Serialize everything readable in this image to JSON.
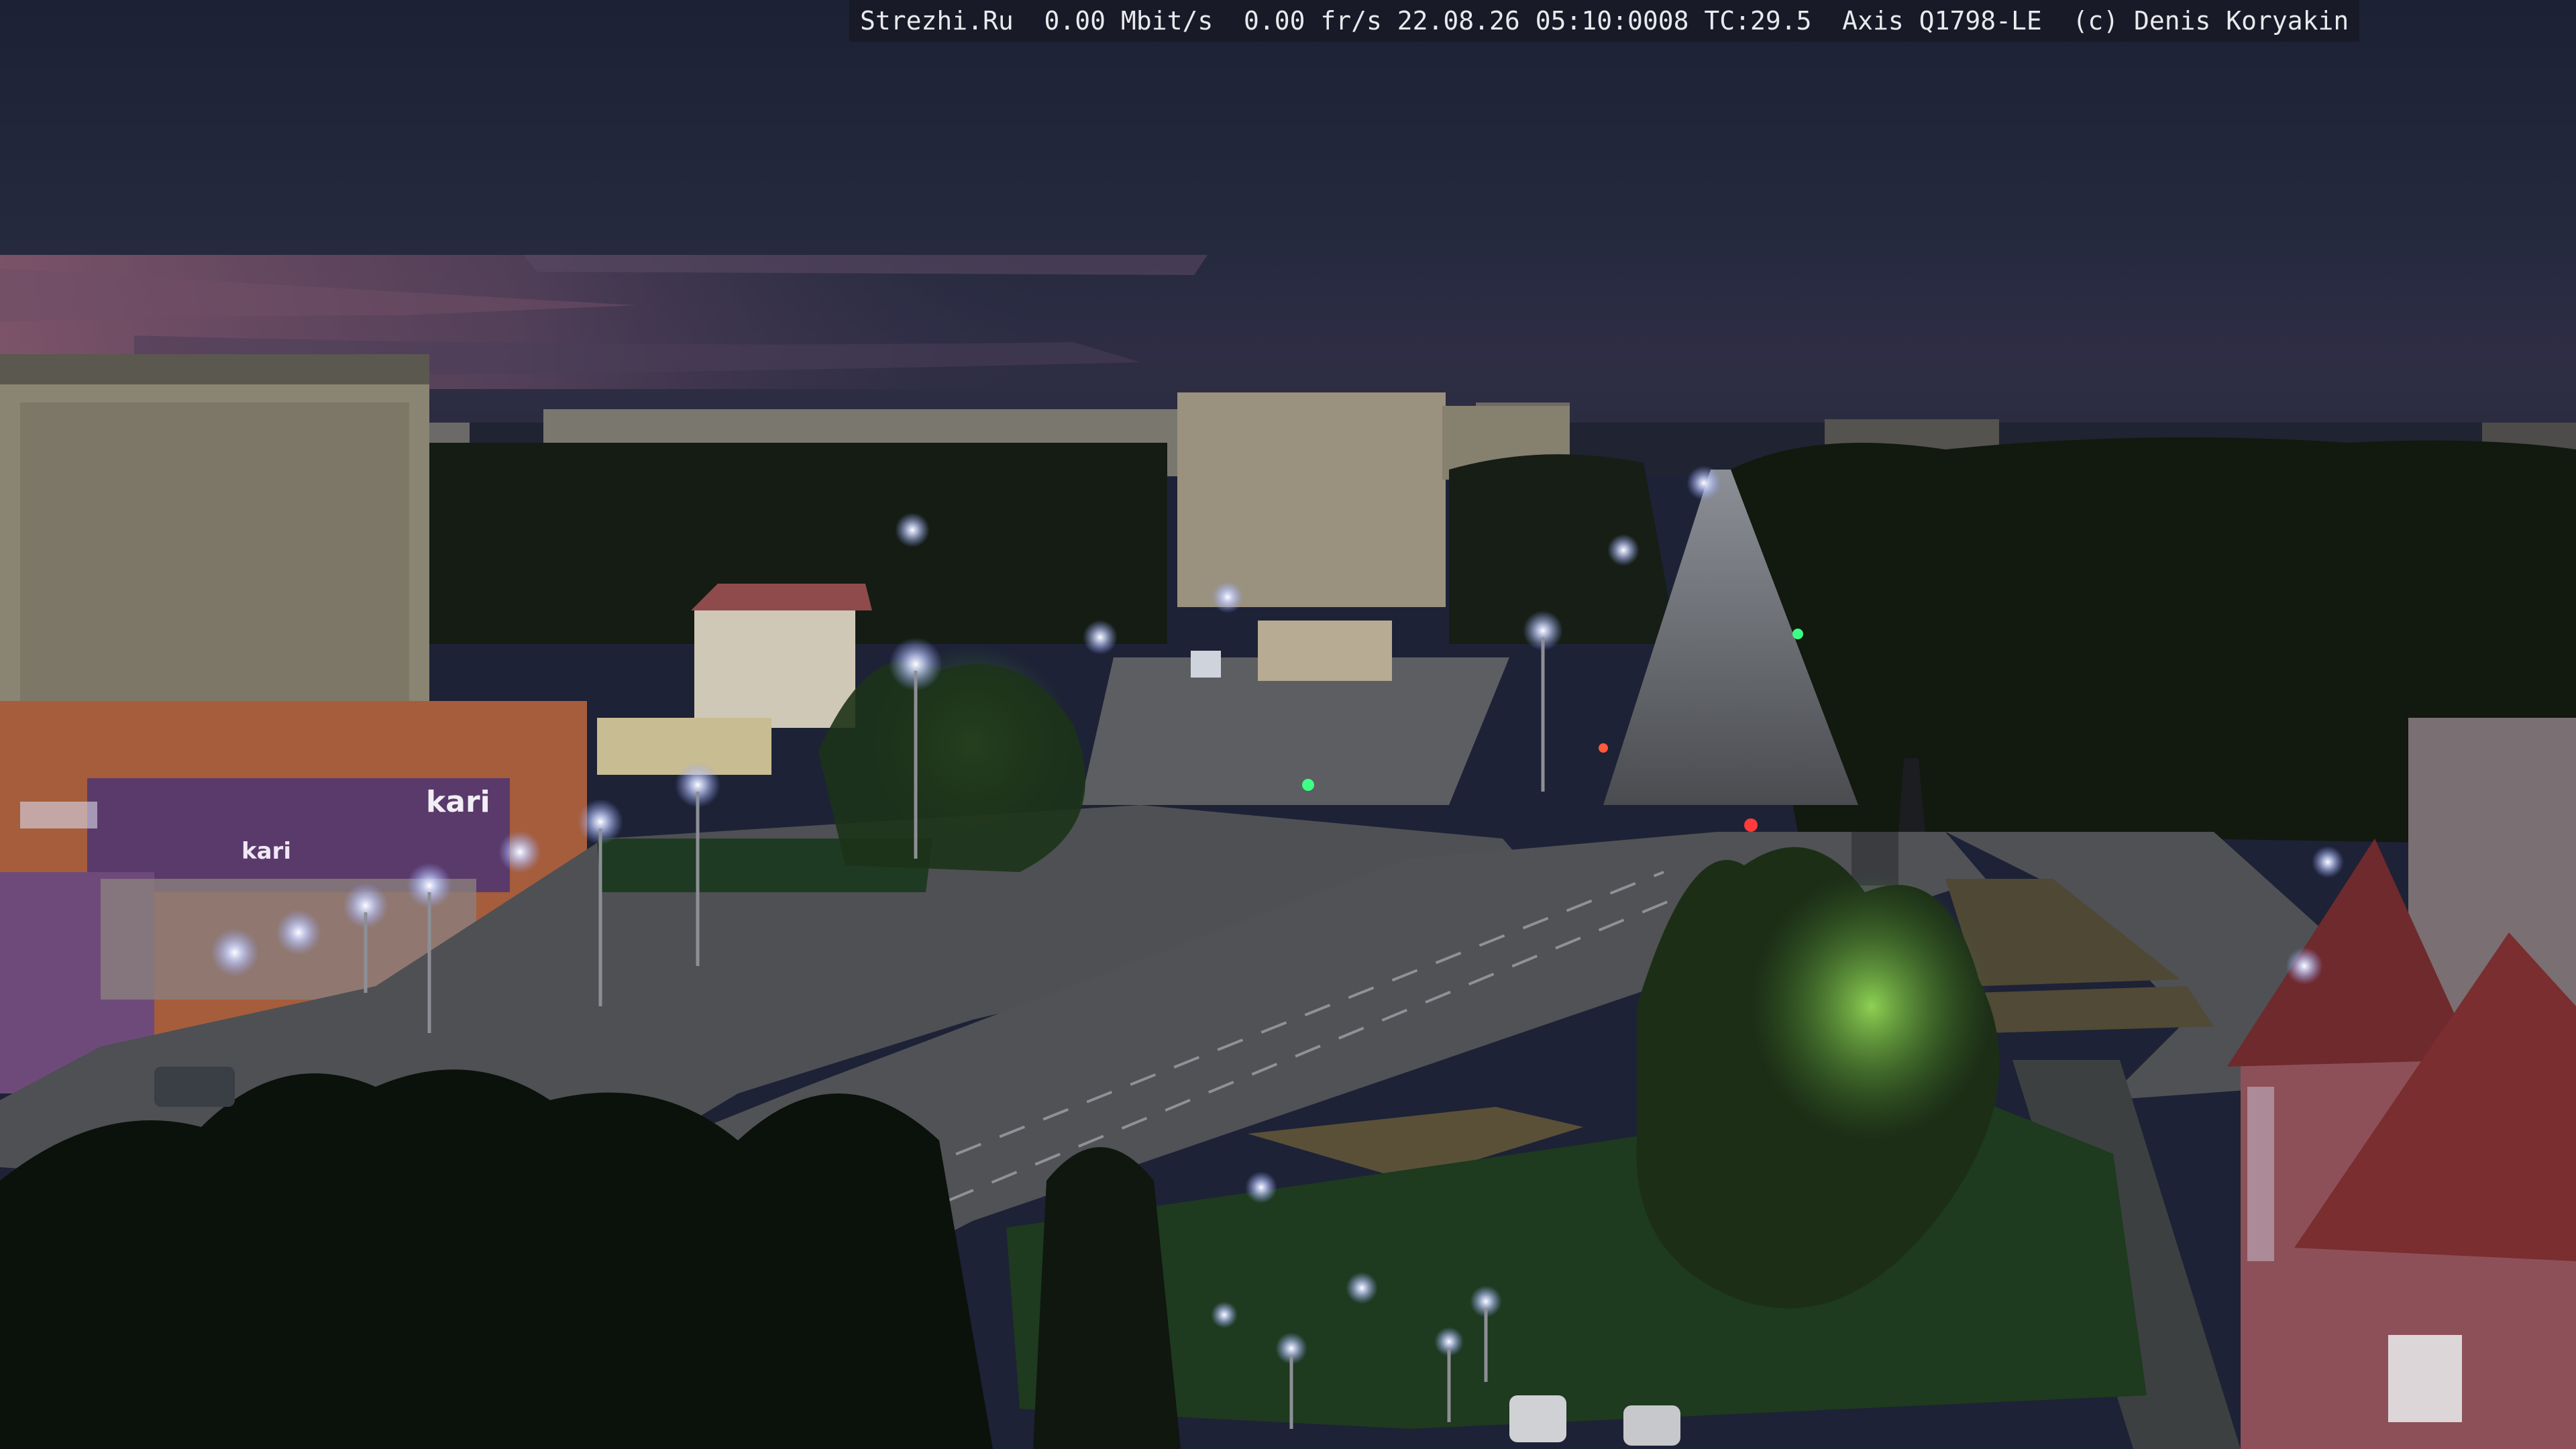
{
  "overlay": {
    "site": "Strezhi.Ru",
    "bitrate": "0.00 Mbit/s",
    "framerate": "0.00 fr/s",
    "date": "22.08.26",
    "time": "05:10:0008",
    "temperature": "TC:29.5",
    "camera": "Axis Q1798-LE",
    "credit": "(c) Denis Koryakin"
  },
  "signage": {
    "store_sign": "kari",
    "store_sign_secondary": "kari"
  },
  "colors": {
    "sky_top": "#1d2236",
    "sky_dusk_pink": "#7a5468",
    "street_light": "#dfe6ff",
    "foliage_dark": "#10180f",
    "foliage_lit": "#7cc94a",
    "road": "#55575a",
    "plaza": "#4e5054",
    "building_panel": "#8c8676",
    "storefront_purple": "#5d3a6e",
    "storefront_orange": "#b0623e",
    "pink_building": "#8a4f55"
  }
}
